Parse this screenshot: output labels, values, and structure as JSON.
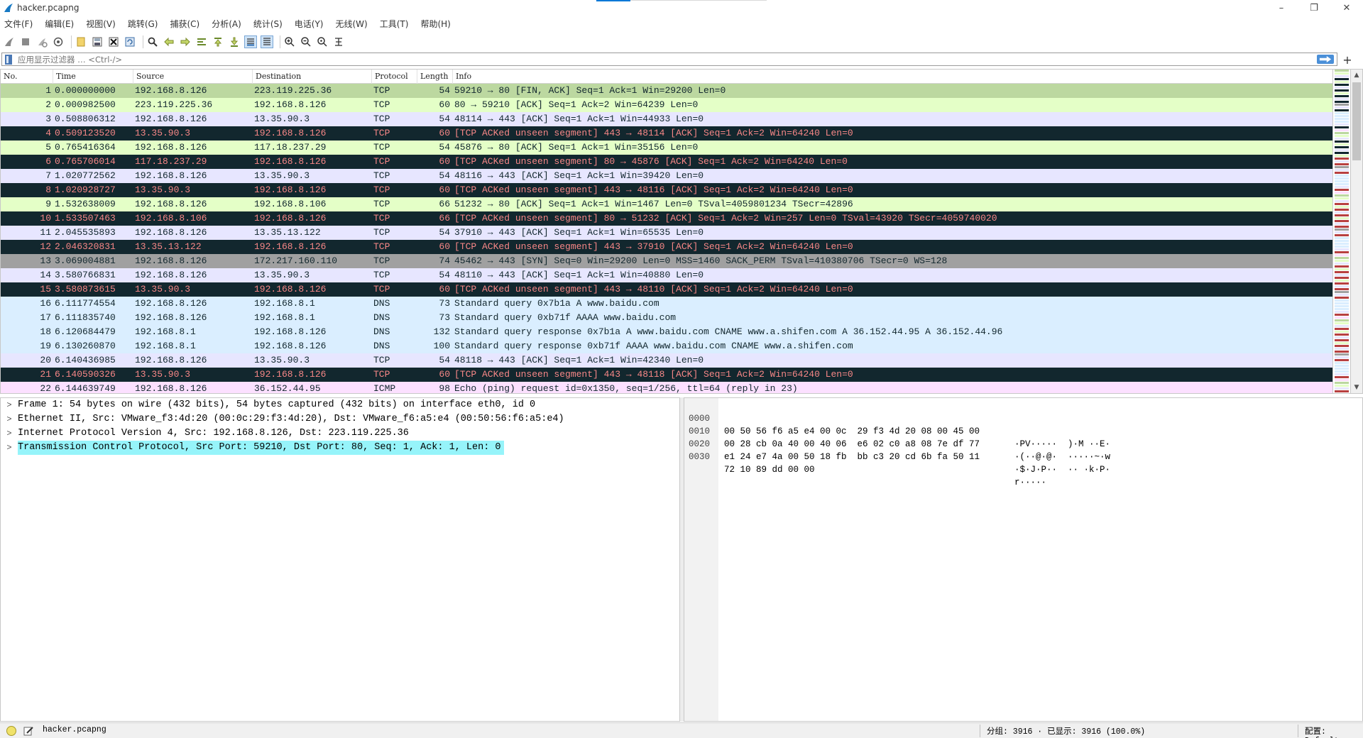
{
  "window": {
    "title": "hacker.pcapng",
    "minimize": "–",
    "restore": "❐",
    "close": "✕"
  },
  "menu": [
    "文件(F)",
    "编辑(E)",
    "视图(V)",
    "跳转(G)",
    "捕获(C)",
    "分析(A)",
    "统计(S)",
    "电话(Y)",
    "无线(W)",
    "工具(T)",
    "帮助(H)"
  ],
  "toolbar": {
    "icons": [
      "shark-fin-start-icon",
      "stop-capture-icon",
      "restart-capture-icon",
      "capture-options-icon",
      "open-file-icon",
      "save-file-icon",
      "close-file-icon",
      "reload-file-icon",
      "find-packet-icon",
      "go-back-icon",
      "go-forward-icon",
      "go-to-packet-icon",
      "go-first-packet-icon",
      "go-last-packet-icon",
      "auto-scroll-icon",
      "colorize-icon",
      "zoom-in-icon",
      "zoom-out-icon",
      "zoom-normal-icon",
      "resize-columns-icon"
    ]
  },
  "filter": {
    "placeholder": "应用显示过滤器 … <Ctrl-/>",
    "value": "",
    "add_button": "+"
  },
  "packet_list": {
    "columns": [
      "No.",
      "Time",
      "Source",
      "Destination",
      "Protocol",
      "Length",
      "Info"
    ],
    "rows": [
      {
        "no": "1",
        "time": "0.000000000",
        "src": "192.168.8.126",
        "dst": "223.119.225.36",
        "proto": "TCP",
        "len": "54",
        "info": "59210 → 80 [FIN, ACK] Seq=1 Ack=1 Win=29200 Len=0",
        "style": "sel"
      },
      {
        "no": "2",
        "time": "0.000982500",
        "src": "223.119.225.36",
        "dst": "192.168.8.126",
        "proto": "TCP",
        "len": "60",
        "info": "80 → 59210 [ACK] Seq=1 Ack=2 Win=64239 Len=0",
        "style": "tcp-ok"
      },
      {
        "no": "3",
        "time": "0.508806312",
        "src": "192.168.8.126",
        "dst": "13.35.90.3",
        "proto": "TCP",
        "len": "54",
        "info": "48114 → 443 [ACK] Seq=1 Ack=1 Win=44933 Len=0",
        "style": "tcp"
      },
      {
        "no": "4",
        "time": "0.509123520",
        "src": "13.35.90.3",
        "dst": "192.168.8.126",
        "proto": "TCP",
        "len": "60",
        "info": "[TCP ACKed unseen segment] 443 → 48114 [ACK] Seq=1 Ack=2 Win=64240 Len=0",
        "style": "bad"
      },
      {
        "no": "5",
        "time": "0.765416364",
        "src": "192.168.8.126",
        "dst": "117.18.237.29",
        "proto": "TCP",
        "len": "54",
        "info": "45876 → 80 [ACK] Seq=1 Ack=1 Win=35156 Len=0",
        "style": "tcp-ok"
      },
      {
        "no": "6",
        "time": "0.765706014",
        "src": "117.18.237.29",
        "dst": "192.168.8.126",
        "proto": "TCP",
        "len": "60",
        "info": "[TCP ACKed unseen segment] 80 → 45876 [ACK] Seq=1 Ack=2 Win=64240 Len=0",
        "style": "bad"
      },
      {
        "no": "7",
        "time": "1.020772562",
        "src": "192.168.8.126",
        "dst": "13.35.90.3",
        "proto": "TCP",
        "len": "54",
        "info": "48116 → 443 [ACK] Seq=1 Ack=1 Win=39420 Len=0",
        "style": "tcp"
      },
      {
        "no": "8",
        "time": "1.020928727",
        "src": "13.35.90.3",
        "dst": "192.168.8.126",
        "proto": "TCP",
        "len": "60",
        "info": "[TCP ACKed unseen segment] 443 → 48116 [ACK] Seq=1 Ack=2 Win=64240 Len=0",
        "style": "bad"
      },
      {
        "no": "9",
        "time": "1.532638009",
        "src": "192.168.8.126",
        "dst": "192.168.8.106",
        "proto": "TCP",
        "len": "66",
        "info": "51232 → 80 [ACK] Seq=1 Ack=1 Win=1467 Len=0 TSval=4059801234 TSecr=42896",
        "style": "tcp-ok"
      },
      {
        "no": "10",
        "time": "1.533507463",
        "src": "192.168.8.106",
        "dst": "192.168.8.126",
        "proto": "TCP",
        "len": "66",
        "info": "[TCP ACKed unseen segment] 80 → 51232 [ACK] Seq=1 Ack=2 Win=257 Len=0 TSval=43920 TSecr=4059740020",
        "style": "bad"
      },
      {
        "no": "11",
        "time": "2.045535893",
        "src": "192.168.8.126",
        "dst": "13.35.13.122",
        "proto": "TCP",
        "len": "54",
        "info": "37910 → 443 [ACK] Seq=1 Ack=1 Win=65535 Len=0",
        "style": "tcp"
      },
      {
        "no": "12",
        "time": "2.046320831",
        "src": "13.35.13.122",
        "dst": "192.168.8.126",
        "proto": "TCP",
        "len": "60",
        "info": "[TCP ACKed unseen segment] 443 → 37910 [ACK] Seq=1 Ack=2 Win=64240 Len=0",
        "style": "bad"
      },
      {
        "no": "13",
        "time": "3.069004881",
        "src": "192.168.8.126",
        "dst": "172.217.160.110",
        "proto": "TCP",
        "len": "74",
        "info": "45462 → 443 [SYN] Seq=0 Win=29200 Len=0 MSS=1460 SACK_PERM TSval=410380706 TSecr=0 WS=128",
        "style": "syn"
      },
      {
        "no": "14",
        "time": "3.580766831",
        "src": "192.168.8.126",
        "dst": "13.35.90.3",
        "proto": "TCP",
        "len": "54",
        "info": "48110 → 443 [ACK] Seq=1 Ack=1 Win=40880 Len=0",
        "style": "tcp"
      },
      {
        "no": "15",
        "time": "3.580873615",
        "src": "13.35.90.3",
        "dst": "192.168.8.126",
        "proto": "TCP",
        "len": "60",
        "info": "[TCP ACKed unseen segment] 443 → 48110 [ACK] Seq=1 Ack=2 Win=64240 Len=0",
        "style": "bad"
      },
      {
        "no": "16",
        "time": "6.111774554",
        "src": "192.168.8.126",
        "dst": "192.168.8.1",
        "proto": "DNS",
        "len": "73",
        "info": "Standard query 0x7b1a A www.baidu.com",
        "style": "dns"
      },
      {
        "no": "17",
        "time": "6.111835740",
        "src": "192.168.8.126",
        "dst": "192.168.8.1",
        "proto": "DNS",
        "len": "73",
        "info": "Standard query 0xb71f AAAA www.baidu.com",
        "style": "dns"
      },
      {
        "no": "18",
        "time": "6.120684479",
        "src": "192.168.8.1",
        "dst": "192.168.8.126",
        "proto": "DNS",
        "len": "132",
        "info": "Standard query response 0x7b1a A www.baidu.com CNAME www.a.shifen.com A 36.152.44.95 A 36.152.44.96",
        "style": "dns"
      },
      {
        "no": "19",
        "time": "6.130260870",
        "src": "192.168.8.1",
        "dst": "192.168.8.126",
        "proto": "DNS",
        "len": "100",
        "info": "Standard query response 0xb71f AAAA www.baidu.com CNAME www.a.shifen.com",
        "style": "dns"
      },
      {
        "no": "20",
        "time": "6.140436985",
        "src": "192.168.8.126",
        "dst": "13.35.90.3",
        "proto": "TCP",
        "len": "54",
        "info": "48118 → 443 [ACK] Seq=1 Ack=1 Win=42340 Len=0",
        "style": "tcp"
      },
      {
        "no": "21",
        "time": "6.140590326",
        "src": "13.35.90.3",
        "dst": "192.168.8.126",
        "proto": "TCP",
        "len": "60",
        "info": "[TCP ACKed unseen segment] 443 → 48118 [ACK] Seq=1 Ack=2 Win=64240 Len=0",
        "style": "bad"
      },
      {
        "no": "22",
        "time": "6.144639749",
        "src": "192.168.8.126",
        "dst": "36.152.44.95",
        "proto": "ICMP",
        "len": "98",
        "info": "Echo (ping) request  id=0x1350, seq=1/256, ttl=64 (reply in 23)",
        "style": "icmp"
      }
    ]
  },
  "details": {
    "rows": [
      {
        "text": "Frame 1: 54 bytes on wire (432 bits), 54 bytes captured (432 bits) on interface eth0, id 0",
        "selected": false
      },
      {
        "text": "Ethernet II, Src: VMware_f3:4d:20 (00:0c:29:f3:4d:20), Dst: VMware_f6:a5:e4 (00:50:56:f6:a5:e4)",
        "selected": false
      },
      {
        "text": "Internet Protocol Version 4, Src: 192.168.8.126, Dst: 223.119.225.36",
        "selected": false
      },
      {
        "text": "Transmission Control Protocol, Src Port: 59210, Dst Port: 80, Seq: 1, Ack: 1, Len: 0",
        "selected": true
      }
    ],
    "arrow": ">"
  },
  "bytes": {
    "rows": [
      {
        "offset": "0000",
        "hex": "00 50 56 f6 a5 e4 00 0c  29 f3 4d 20 08 00 45 00",
        "ascii": "·PV·····  )·M ··E·"
      },
      {
        "offset": "0010",
        "hex": "00 28 cb 0a 40 00 40 06  e6 02 c0 a8 08 7e df 77",
        "ascii": "·(··@·@·  ·····~·w"
      },
      {
        "offset": "0020",
        "hex": "e1 24 e7 4a 00 50 18 fb  bb c3 20 cd 6b fa 50 11",
        "ascii": "·$·J·P··  ·· ·k·P·"
      },
      {
        "offset": "0030",
        "hex": "72 10 89 dd 00 00",
        "ascii": "r·····"
      }
    ]
  },
  "status": {
    "file": "hacker.pcapng",
    "packets": "分组: 3916 · 已显示: 3916 (100.0%)",
    "profile": "配置: Default"
  },
  "colors": {
    "accent": "#0078d7",
    "bad_bg": "#12272e",
    "bad_fg": "#f78787",
    "dns_bg": "#daeeff",
    "tcp_bg": "#e7e6ff"
  }
}
